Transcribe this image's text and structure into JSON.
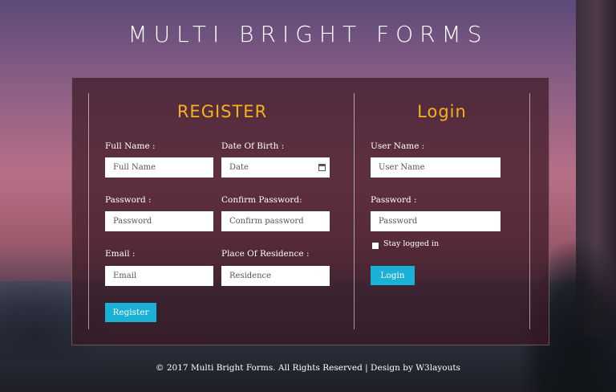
{
  "page": {
    "title": "Multi Bright Forms",
    "footer": "© 2017 Multi Bright Forms. All Rights Reserved | Design by W3layouts"
  },
  "register": {
    "heading": "Register",
    "full_name": {
      "label": "Full Name :",
      "placeholder": "Full Name"
    },
    "dob": {
      "label": "Date Of Birth :",
      "placeholder": "Date"
    },
    "password": {
      "label": "Password :",
      "placeholder": "Password"
    },
    "confirm_password": {
      "label": "Confirm Password:",
      "placeholder": "Confirm password"
    },
    "email": {
      "label": "Email :",
      "placeholder": "Email"
    },
    "residence": {
      "label": "Place Of Residence :",
      "placeholder": "Residence"
    },
    "submit_label": "Register"
  },
  "login": {
    "heading": "Login",
    "username": {
      "label": "User Name :",
      "placeholder": "User Name"
    },
    "password": {
      "label": "Password :",
      "placeholder": "Password"
    },
    "stay_logged_in": "Stay logged in",
    "submit_label": "Login"
  },
  "colors": {
    "accent_button": "#19b1d6",
    "heading": "#f5b21d",
    "panel_background": "rgba(60,24,36,0.72)"
  },
  "icons": {
    "date_field": "calendar-icon"
  }
}
